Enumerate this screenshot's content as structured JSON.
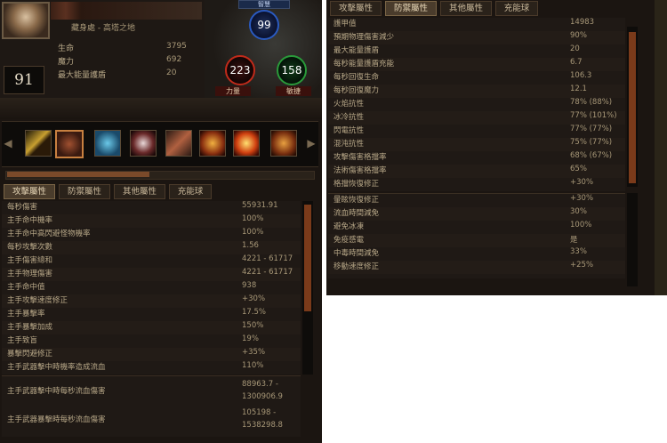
{
  "character": {
    "class_name": "藏身處 - 高塔之地",
    "level": "91"
  },
  "mini_stats": [
    {
      "label": "生命",
      "value": "3795"
    },
    {
      "label": "魔力",
      "value": "692"
    },
    {
      "label": "最大能量護盾",
      "value": "20"
    }
  ],
  "orbs": {
    "top_label": "智慧",
    "intelligence": "99",
    "strength": "223",
    "dexterity": "158",
    "strength_label": "力量",
    "dexterity_label": "敏捷"
  },
  "colors": {
    "panel_bg": "#1b1511",
    "text": "#c9b89a",
    "value_text": "#a89878",
    "orb_blue": "#2a5ac0",
    "orb_red": "#c02a1a",
    "orb_green": "#2a9a3a"
  },
  "skills": [
    {
      "icon": "sword-skill-icon"
    },
    {
      "icon": "slam-skill-icon"
    },
    {
      "icon": "ice-skill-icon"
    },
    {
      "icon": "skull-skill-icon"
    },
    {
      "icon": "blade-skill-icon"
    },
    {
      "icon": "fire-skill-icon"
    },
    {
      "icon": "flame-skill-icon"
    },
    {
      "icon": "scroll-skill-icon"
    }
  ],
  "left_tabs": [
    "攻擊屬性",
    "防禦屬性",
    "其他屬性",
    "充能球"
  ],
  "right_tabs": [
    "攻擊屬性",
    "防禦屬性",
    "其他屬性",
    "充能球"
  ],
  "attack_stats": [
    {
      "label": "每秒傷害",
      "value": "55931.91"
    },
    {
      "label": "主手命中機率",
      "value": "100%"
    },
    {
      "label": "主手命中高閃避怪物機率",
      "value": "100%"
    },
    {
      "label": "每秒攻擊次數",
      "value": "1.56"
    },
    {
      "label": "主手傷害總和",
      "value": "4221 - 61717"
    },
    {
      "label": "主手物理傷害",
      "value": "4221 - 61717"
    },
    {
      "label": "主手命中值",
      "value": "938"
    },
    {
      "label": "主手攻擊速度修正",
      "value": "+30%"
    },
    {
      "label": "主手暴擊率",
      "value": "17.5%"
    },
    {
      "label": "主手暴擊加成",
      "value": "150%"
    },
    {
      "label": "主手致盲",
      "value": "19%"
    },
    {
      "label": "暴擊閃避修正",
      "value": "+35%"
    },
    {
      "label": "主手武器擊中時機率造成流血",
      "value": "110%"
    }
  ],
  "bleed_stats": [
    {
      "label": "主手武器擊中時每秒流血傷害",
      "value_line1": "88963.7 -",
      "value_line2": "1300906.9"
    },
    {
      "label": "主手武器暴擊時每秒流血傷害",
      "value_line1": "105198 -",
      "value_line2": "1538298.8"
    }
  ],
  "defense_stats": [
    {
      "label": "護甲值",
      "value": "14983"
    },
    {
      "label": "預期物理傷害減少",
      "value": "90%"
    },
    {
      "label": "最大能量護盾",
      "value": "20"
    },
    {
      "label": "每秒能量護盾充能",
      "value": "6.7"
    },
    {
      "label": "每秒回復生命",
      "value": "106.3"
    },
    {
      "label": "每秒回復魔力",
      "value": "12.1"
    },
    {
      "label": "火焰抗性",
      "value": "78% (88%)"
    },
    {
      "label": "冰冷抗性",
      "value": "77% (101%)"
    },
    {
      "label": "閃電抗性",
      "value": "77% (77%)"
    },
    {
      "label": "混沌抗性",
      "value": "75% (77%)"
    },
    {
      "label": "攻擊傷害格擋率",
      "value": "68% (67%)"
    },
    {
      "label": "法術傷害格擋率",
      "value": "65%"
    },
    {
      "label": "格擋恢復修正",
      "value": "+30%"
    }
  ],
  "defense_stats_2": [
    {
      "label": "暈眩恢復修正",
      "value": "+30%"
    },
    {
      "label": "流血時間減免",
      "value": "30%"
    },
    {
      "label": "避免冰凍",
      "value": "100%"
    },
    {
      "label": "免疫感電",
      "value": "是"
    },
    {
      "label": "中毒時間減免",
      "value": "33%"
    },
    {
      "label": "移動速度修正",
      "value": "+25%"
    }
  ]
}
